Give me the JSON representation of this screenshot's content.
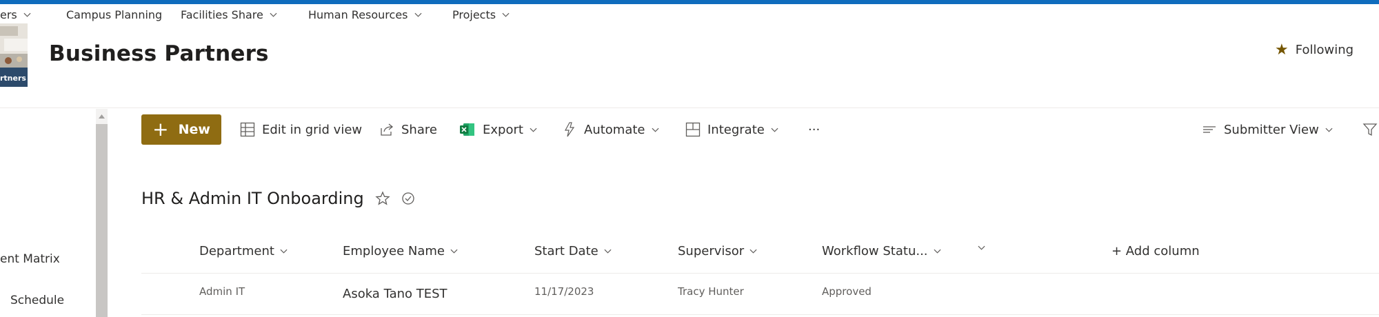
{
  "colors": {
    "accent": "#0f6cbd",
    "new_button": "#8f6c12",
    "star": "#745500"
  },
  "hub_nav": {
    "items": [
      {
        "label": "ers",
        "has_dropdown": true
      },
      {
        "label": "Campus Planning",
        "has_dropdown": false
      },
      {
        "label": "Facilities Share",
        "has_dropdown": true
      },
      {
        "label": "Human Resources",
        "has_dropdown": true
      },
      {
        "label": "Projects",
        "has_dropdown": true
      }
    ]
  },
  "site": {
    "title": "Business Partners",
    "logo_text": "rtners",
    "following_label": "Following"
  },
  "left_nav": {
    "items": [
      {
        "label": "ent Matrix"
      },
      {
        "label": "Schedule"
      }
    ]
  },
  "command_bar": {
    "new_label": "New",
    "edit_grid_label": "Edit in grid view",
    "share_label": "Share",
    "export_label": "Export",
    "automate_label": "Automate",
    "integrate_label": "Integrate",
    "more_label": "···",
    "view_label": "Submitter View"
  },
  "list": {
    "title": "HR & Admin IT Onboarding",
    "columns": [
      {
        "label": "Department"
      },
      {
        "label": "Employee Name"
      },
      {
        "label": "Start Date"
      },
      {
        "label": "Supervisor"
      },
      {
        "label": "Workflow Statu..."
      }
    ],
    "add_column_label": "+ Add column",
    "rows": [
      {
        "department": "Admin IT",
        "employee_name": "Asoka Tano TEST",
        "start_date": "11/17/2023",
        "supervisor": "Tracy Hunter",
        "workflow_status": "Approved"
      }
    ]
  }
}
